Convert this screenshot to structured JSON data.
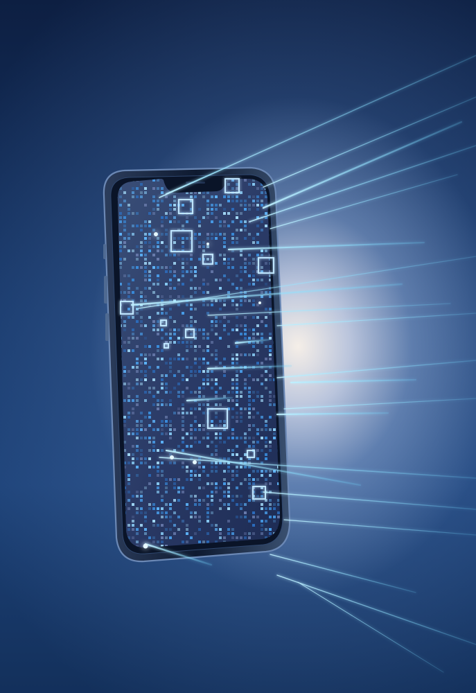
{
  "scene": {
    "subject": "smartphone",
    "colors": {
      "background_dark": "#0d1f42",
      "background_mid": "#1d4278",
      "glow": "#fff6ec",
      "accent_cyan": "#6fd8ff",
      "pixel_blue": "#3a8fe0",
      "phone_frame": "#1c2a44"
    }
  }
}
